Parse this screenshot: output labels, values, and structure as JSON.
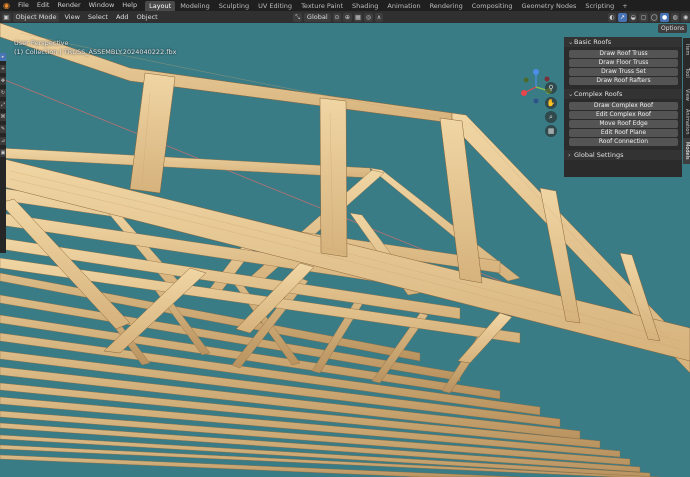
{
  "topbar": {
    "menus": [
      "File",
      "Edit",
      "Render",
      "Window",
      "Help"
    ],
    "workspaces": [
      "Layout",
      "Modeling",
      "Sculpting",
      "UV Editing",
      "Texture Paint",
      "Shading",
      "Animation",
      "Rendering",
      "Compositing",
      "Geometry Nodes",
      "Scripting"
    ],
    "active_workspace": "Layout",
    "add_tab": "+"
  },
  "header": {
    "mode": "Object Mode",
    "menus": [
      "View",
      "Select",
      "Add",
      "Object"
    ],
    "orientation": "Global",
    "options": "Options"
  },
  "viewport": {
    "view_name": "User Perspective",
    "collection_path": "(1) Collection | TRUSS_ASSEMBLY.2024040222.fbx",
    "background_color": "#3a7c86"
  },
  "side_tabs": [
    "Item",
    "Tool",
    "View",
    "Animation",
    "Models"
  ],
  "active_side_tab": "Models",
  "panel": {
    "basic": {
      "title": "Basic Roofs",
      "buttons": [
        "Draw Roof Truss",
        "Draw Floor Truss",
        "Draw Truss Set",
        "Draw Roof Rafters"
      ]
    },
    "complex": {
      "title": "Complex Roofs",
      "buttons": [
        "Draw Complex Roof",
        "Edit Complex Roof",
        "Move Roof Edge",
        "Edit Roof Plane",
        "Roof Connection"
      ]
    },
    "global": {
      "title": "Global Settings"
    }
  },
  "gizmo": {
    "x_color": "#e8454c",
    "y_color": "#8bc54a",
    "z_color": "#4b8fe8"
  },
  "icons": [
    "blender-logo",
    "move-icon",
    "hand-icon",
    "camera-icon",
    "grid-icon"
  ]
}
